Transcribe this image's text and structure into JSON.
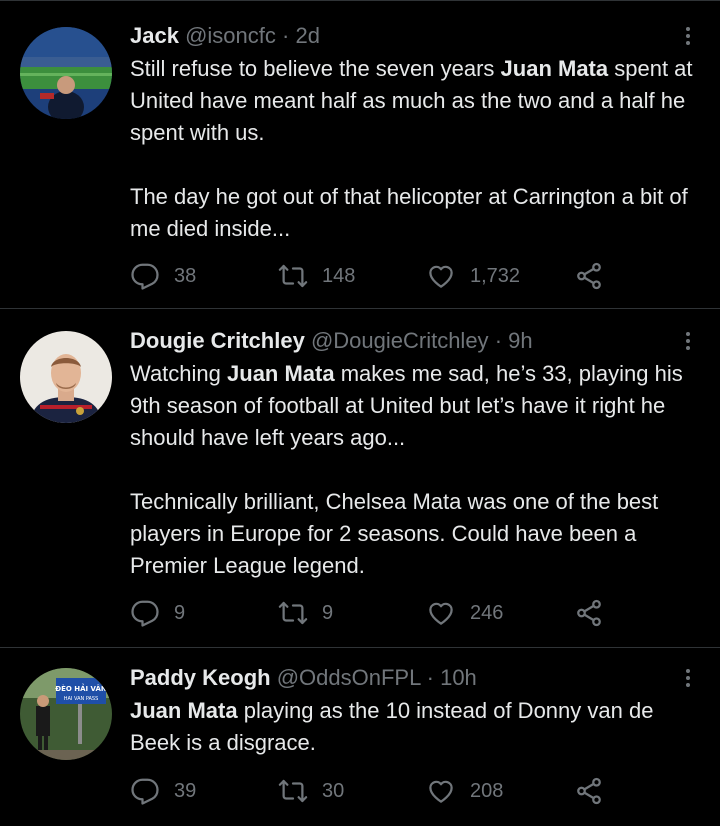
{
  "tweets": [
    {
      "name": "Jack",
      "handle": "@isoncfc",
      "separator": "·",
      "time": "2d",
      "p1_a": "Still refuse to believe the seven years ",
      "p1_b": "Juan Mata",
      "p1_c": " spent at United have meant half as much as the two and a half he spent with us.",
      "p2_a": "The day he got out of that helicopter at Carrington a bit of me died inside...",
      "replies": "38",
      "retweets": "148",
      "likes": "1,732"
    },
    {
      "name": "Dougie Critchley",
      "handle": "@DougieCritchley",
      "separator": "·",
      "time": "9h",
      "p1_a": "Watching ",
      "p1_b": "Juan Mata",
      "p1_c": " makes me sad, he’s 33, playing his 9th season of football at United but let’s have it right he should have left years ago...",
      "p2_a": "Technically brilliant, Chelsea Mata was one of the best players in Europe for 2 seasons. Could have been a Premier League legend.",
      "replies": "9",
      "retweets": "9",
      "likes": "246"
    },
    {
      "name": "Paddy Keogh",
      "handle": "@OddsOnFPL",
      "separator": "·",
      "time": "10h",
      "p1_a": "",
      "p1_b": "Juan Mata",
      "p1_c": " playing as the 10 instead of Donny van de Beek is a disgrace.",
      "replies": "39",
      "retweets": "30",
      "likes": "208",
      "avatar_sign": "ĐÈO HẢI VÂN",
      "avatar_sign_sub": "HAI VAN PASS"
    }
  ],
  "icons": [
    "reply-icon",
    "retweet-icon",
    "like-icon",
    "share-icon",
    "more-icon"
  ],
  "colors": {
    "background": "#000000",
    "text": "#e7e9ea",
    "muted": "#71767b",
    "divider": "#2f3336"
  }
}
